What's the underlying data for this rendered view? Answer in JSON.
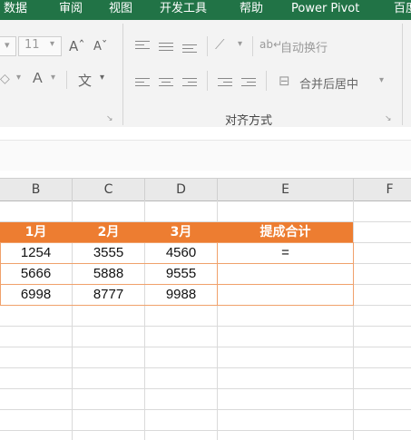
{
  "ribbon_tabs": [
    "数据",
    "审阅",
    "视图",
    "开发工具",
    "帮助",
    "Power Pivot",
    "百度"
  ],
  "font": {
    "size": "11",
    "grow_label": "Aˆ",
    "shrink_label": "Aˇ",
    "color_label": "A",
    "phonetic_label": "文"
  },
  "alignment": {
    "wrap_text_label": "自动换行",
    "merge_center_label": "合并后居中",
    "group_label": "对齐方式"
  },
  "columns": [
    "B",
    "C",
    "D",
    "E",
    "F"
  ],
  "table": {
    "headers": [
      "1月",
      "2月",
      "3月",
      "提成合计"
    ],
    "rows": [
      [
        "1254",
        "3555",
        "4560",
        "="
      ],
      [
        "5666",
        "5888",
        "9555",
        ""
      ],
      [
        "6998",
        "8777",
        "9988",
        ""
      ]
    ]
  },
  "colors": {
    "ribbon_green": "#217346",
    "header_orange": "#ed7d31",
    "border_orange": "#f0a16b"
  }
}
